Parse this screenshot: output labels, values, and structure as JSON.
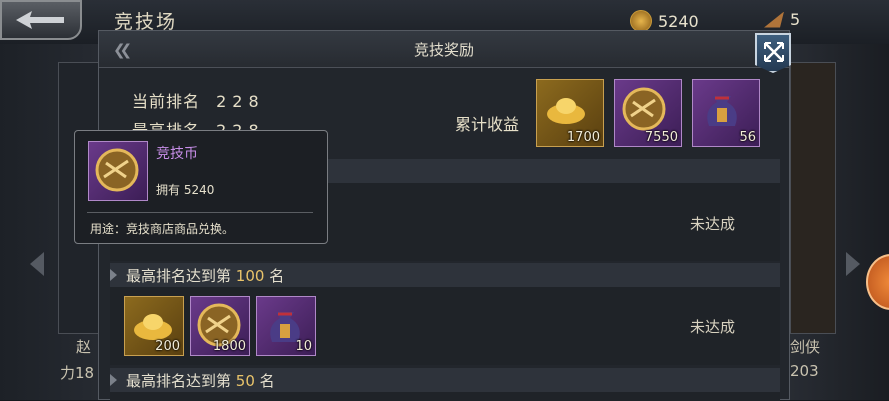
{
  "background": {
    "title": "竞技场",
    "coins": "5240",
    "horns": "5",
    "left_name_prefix": "赵",
    "left_power_prefix": "力18",
    "right_name_suffix": "剑侠",
    "right_power_suffix": "203"
  },
  "dialog": {
    "title": "竞技奖励",
    "current_rank_label": "当前排名",
    "current_rank_value": "228",
    "best_rank_label": "最高排名",
    "best_rank_value": "228",
    "total_label": "累计收益",
    "total_items": [
      {
        "icon": "gold-ingot-icon",
        "qty": "1700"
      },
      {
        "icon": "arena-coin-icon",
        "qty": "7550"
      },
      {
        "icon": "treasure-bag-icon",
        "qty": "56"
      }
    ],
    "sections": [
      {
        "prefix": "最高排名达到第",
        "rank": "100",
        "suffix": "名",
        "status": "未达成",
        "items": [
          {
            "icon": "gold-ingot-icon",
            "qty": "200"
          },
          {
            "icon": "arena-coin-icon",
            "qty": "1800"
          },
          {
            "icon": "treasure-bag-icon",
            "qty": "10"
          }
        ]
      },
      {
        "prefix": "最高排名达到第",
        "rank": "50",
        "suffix": "名"
      }
    ],
    "hidden_row": {
      "status": "未达成"
    }
  },
  "tooltip": {
    "name": "竞技币",
    "owned": "拥有 5240",
    "usage": "用途：竞技商店商品兑换。"
  },
  "colors": {
    "purple_name": "#c78ee8",
    "rank_highlight": "#e8c36a"
  }
}
